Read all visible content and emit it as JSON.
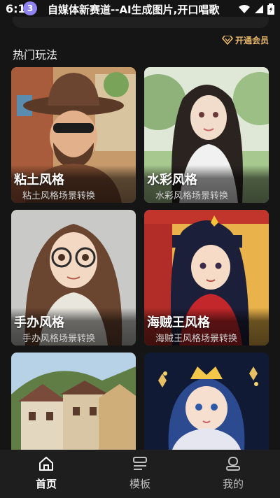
{
  "status_bar": {
    "time": "6:15",
    "notification_count": "3",
    "notification_title": "自媒体新赛道--AI生成图片,开口唱歌"
  },
  "vip_link": {
    "label": "开通会员",
    "color": "#e8b86b"
  },
  "section": {
    "title": "热门玩法"
  },
  "cards": [
    {
      "title": "粘土风格",
      "subtitle": "粘土风格场景转换",
      "icon": "clay-cowboy-figure-image"
    },
    {
      "title": "水彩风格",
      "subtitle": "水彩风格场景转换",
      "icon": "watercolor-girl-park-image"
    },
    {
      "title": "手办风格",
      "subtitle": "手办风格场景转换",
      "icon": "figurine-girl-glasses-image"
    },
    {
      "title": "海贼王风格",
      "subtitle": "海贼王风格场景转换",
      "icon": "one-piece-girl-image"
    },
    {
      "title": "",
      "subtitle": "",
      "icon": "village-houses-image"
    },
    {
      "title": "",
      "subtitle": "",
      "icon": "anime-princess-crown-image"
    }
  ],
  "bottom_nav": {
    "items": [
      {
        "label": "首页",
        "icon": "home-icon",
        "active": true
      },
      {
        "label": "模板",
        "icon": "template-icon",
        "active": false
      },
      {
        "label": "我的",
        "icon": "profile-icon",
        "active": false
      }
    ]
  },
  "colors": {
    "background": "#151515",
    "nav_background": "#1e1e1e",
    "accent_gold": "#e8b86b",
    "badge_purple": "#8f84f0"
  }
}
